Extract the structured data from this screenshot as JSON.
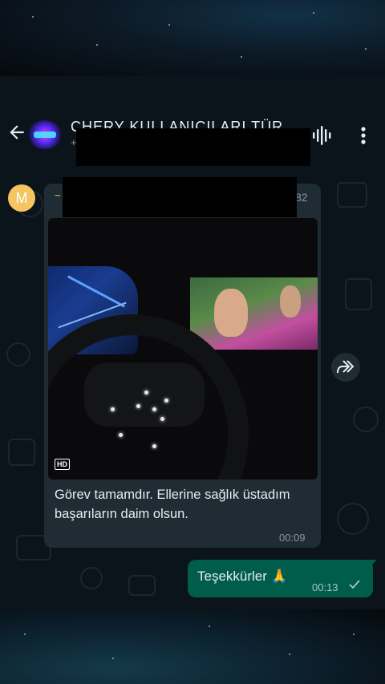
{
  "header": {
    "title": "CHERY KULLANICILARI TÜR",
    "subtitle": "+",
    "back_icon": "arrow-left-icon",
    "voice_icon": "voice-chat-icon",
    "menu_icon": "more-vert-icon"
  },
  "message_in": {
    "avatar_letter": "M",
    "sender_name": "~",
    "sender_number_suffix": "82",
    "video_badge": "HD",
    "text": "Görev tamamdır. Ellerine sağlık üstadım başarıların daim olsun.",
    "time": "00:09",
    "forward_icon": "forward-icon"
  },
  "message_out": {
    "text": "Teşekkürler 🙏",
    "time": "00:13",
    "status_icon": "single-check-icon"
  },
  "colors": {
    "chat_bg": "#0b141a",
    "bubble_in": "#1f2c34",
    "bubble_out": "#005c4b",
    "avatar": "#f4c560",
    "meta_text": "#8696a0"
  }
}
